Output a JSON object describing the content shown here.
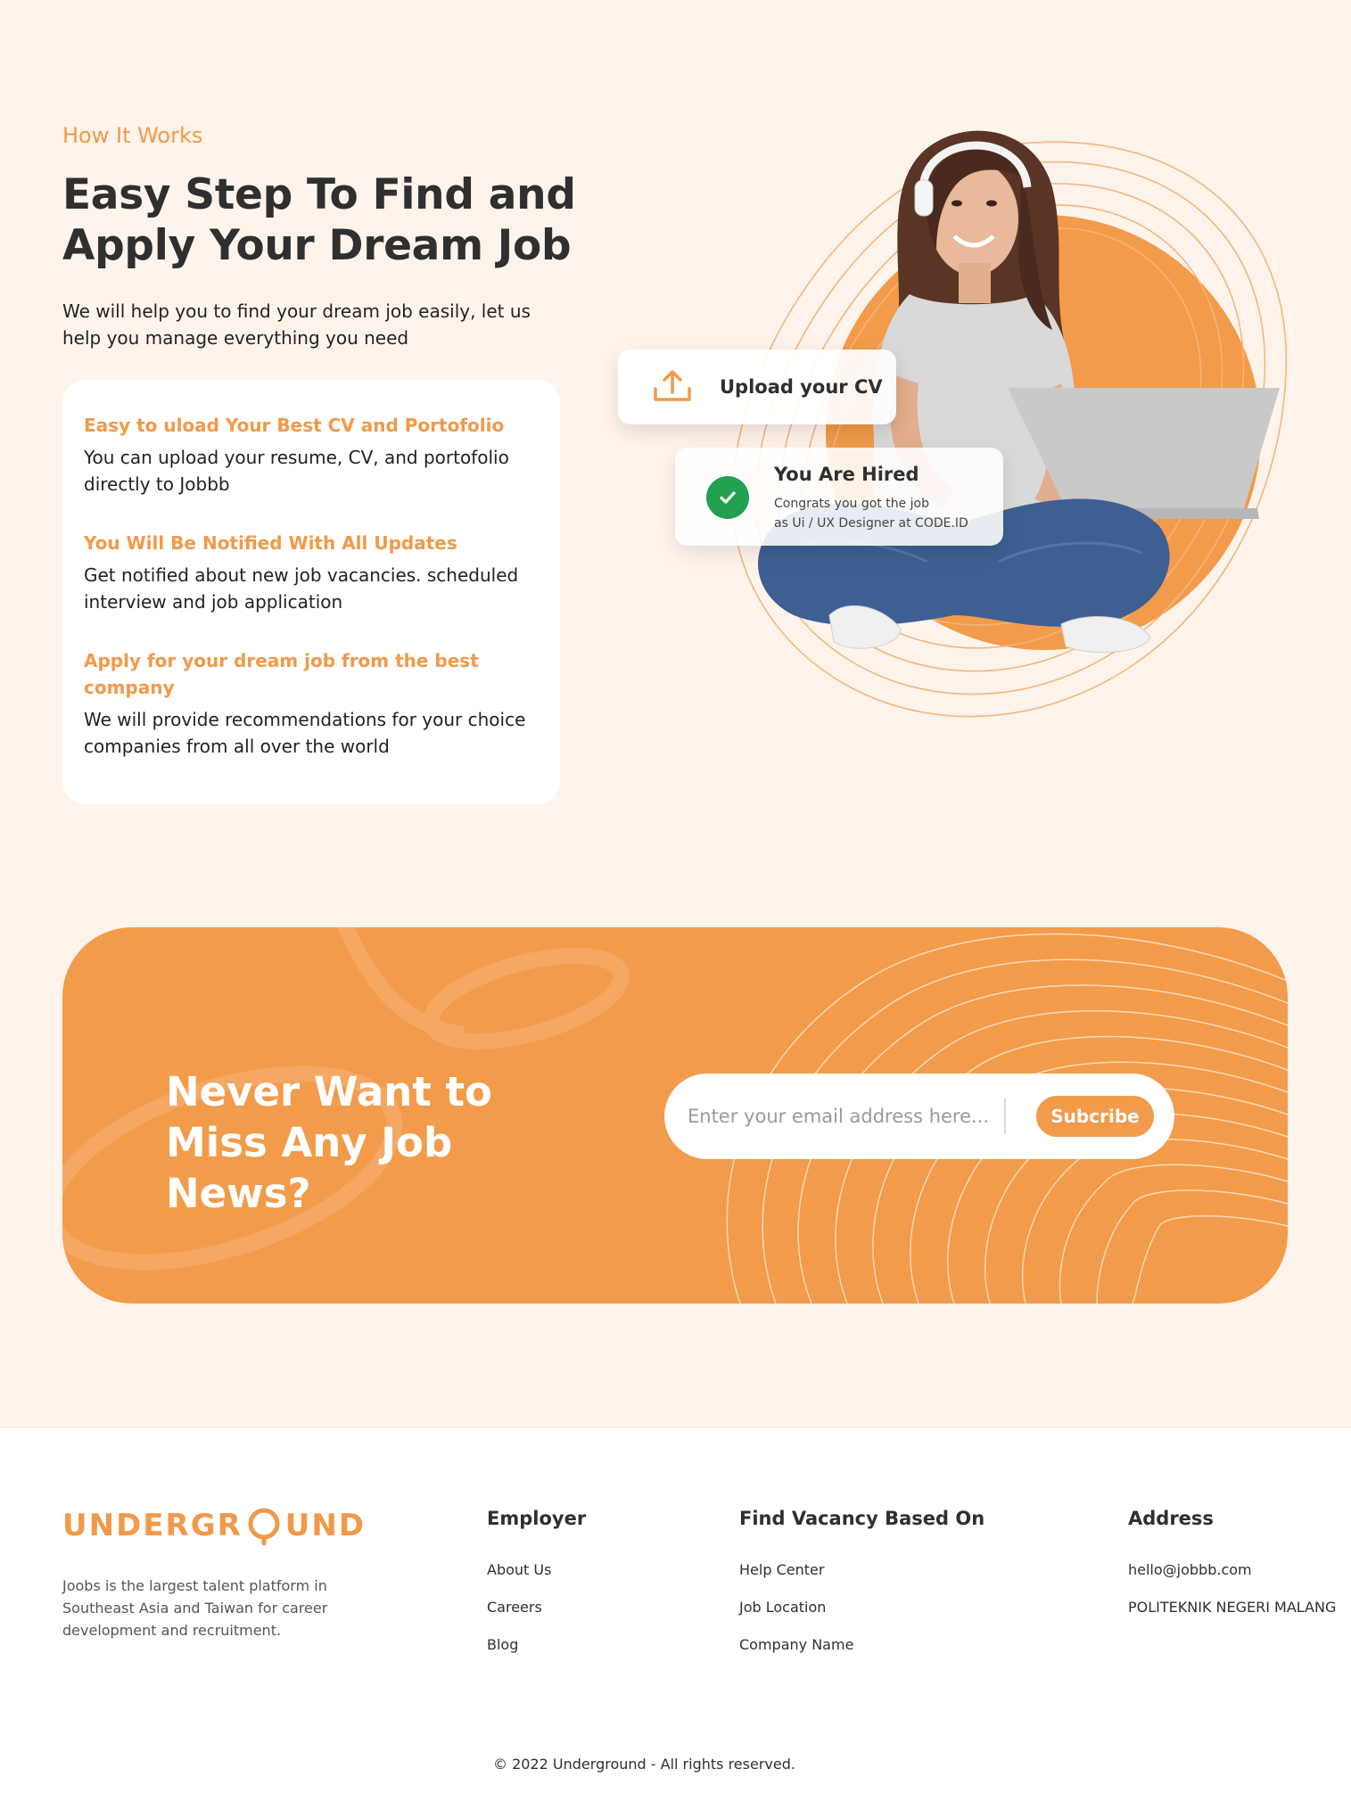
{
  "how_it_works": {
    "eyebrow": "How It Works",
    "headline": "Easy Step To Find and Apply Your Dream Job",
    "intro": "We will help you to find your dream job easily, let us help you manage everything you need",
    "features": [
      {
        "title": "Easy to uload Your Best CV and Portofolio",
        "desc": "You can upload your resume, CV, and portofolio directly to Jobbb"
      },
      {
        "title": "You Will Be Notified With All Updates",
        "desc": "Get notified about new job vacancies. scheduled interview and job application"
      },
      {
        "title": "Apply for your dream job from the best company",
        "desc": "We will provide recommendations for your choice companies from all over the world"
      }
    ]
  },
  "hero": {
    "upload_card_label": "Upload your CV",
    "hired_card": {
      "title": "You Are Hired",
      "line1": "Congrats you got the job",
      "line2": "as Ui / UX Designer at CODE.ID"
    }
  },
  "newsletter": {
    "title": "Never Want to Miss Any Job News?",
    "email_placeholder": "Enter your email address here...",
    "subscribe_label": "Subcribe"
  },
  "footer": {
    "brand": {
      "part1": "UNDERGR",
      "part2": "UND"
    },
    "brand_desc": "Joobs is the largest talent platform in Southeast Asia and Taiwan for career development and recruitment.",
    "columns": [
      {
        "title": "Employer",
        "links": [
          "About Us",
          "Careers",
          "Blog"
        ]
      },
      {
        "title": "Find Vacancy Based On",
        "links": [
          "Help Center",
          "Job Location",
          "Company Name"
        ]
      },
      {
        "title": "Address",
        "links": [
          "hello@jobbb.com",
          "POLITEKNIK NEGERI MALANG"
        ]
      }
    ],
    "copyright": "© 2022 Underground - All rights reserved."
  },
  "colors": {
    "accent": "#f2994a",
    "page_bg": "#fff4ec",
    "success": "#21a050"
  }
}
